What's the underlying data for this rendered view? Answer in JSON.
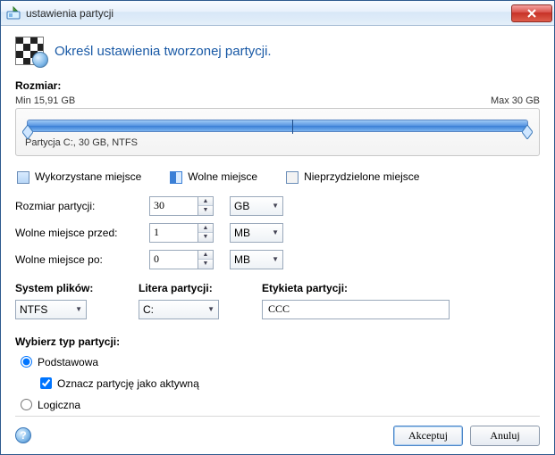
{
  "window": {
    "title": "ustawienia partycji"
  },
  "heading": "Określ ustawienia tworzonej partycji.",
  "size": {
    "label": "Rozmiar:",
    "min_label": "Min 15,91 GB",
    "max_label": "Max 30 GB",
    "partition_caption": "Partycja C:, 30 GB, NTFS",
    "used_marker_percent": 53,
    "thumb_left_percent": 0,
    "thumb_right_percent": 100
  },
  "legend": {
    "used": "Wykorzystane miejsce",
    "free": "Wolne miejsce",
    "unallocated": "Nieprzydzielone miejsce"
  },
  "fields": {
    "partition_size": {
      "label": "Rozmiar partycji:",
      "value": "30",
      "unit": "GB"
    },
    "free_before": {
      "label": "Wolne miejsce przed:",
      "value": "1",
      "unit": "MB"
    },
    "free_after": {
      "label": "Wolne miejsce po:",
      "value": "0",
      "unit": "MB"
    }
  },
  "fs": {
    "filesystem_label": "System plików:",
    "filesystem_value": "NTFS",
    "drive_letter_label": "Litera partycji:",
    "drive_letter_value": "C:",
    "volume_label_label": "Etykieta partycji:",
    "volume_label_value": "CCC"
  },
  "type": {
    "label": "Wybierz typ partycji:",
    "primary": "Podstawowa",
    "active_checkbox": "Oznacz partycję jako aktywną",
    "logical": "Logiczna",
    "selected": "primary",
    "active_checked": true
  },
  "buttons": {
    "accept": "Akceptuj",
    "cancel": "Anuluj"
  }
}
